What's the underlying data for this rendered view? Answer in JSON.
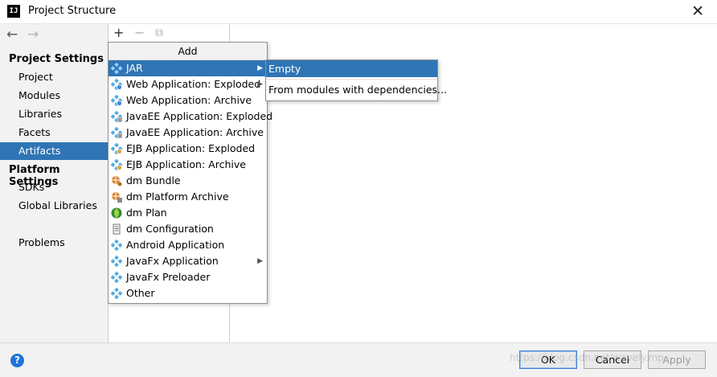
{
  "window": {
    "title": "Project Structure",
    "app_icon_text": "IJ",
    "close_glyph": "✕"
  },
  "nav": {
    "back_glyph": "←",
    "forward_glyph": "→"
  },
  "sidebar": {
    "project_settings_title": "Project Settings",
    "project_items": [
      "Project",
      "Modules",
      "Libraries",
      "Facets",
      "Artifacts"
    ],
    "selected": "Artifacts",
    "platform_settings_title": "Platform Settings",
    "platform_items": [
      "SDKs",
      "Global Libraries"
    ],
    "other_items": [
      "Problems"
    ]
  },
  "toolbar": {
    "add_glyph": "+",
    "remove_glyph": "−",
    "copy_glyph": "⧉"
  },
  "add_menu": {
    "title": "Add",
    "items": [
      {
        "label": "JAR",
        "icon": "artifact-diamond-icon",
        "has_submenu": true,
        "selected": true
      },
      {
        "label": "Web Application: Exploded",
        "icon": "web-app-icon",
        "has_submenu": true
      },
      {
        "label": "Web Application: Archive",
        "icon": "web-app-icon"
      },
      {
        "label": "JavaEE Application: Exploded",
        "icon": "javaee-app-icon"
      },
      {
        "label": "JavaEE Application: Archive",
        "icon": "javaee-app-icon"
      },
      {
        "label": "EJB Application: Exploded",
        "icon": "ejb-app-icon"
      },
      {
        "label": "EJB Application: Archive",
        "icon": "ejb-app-icon"
      },
      {
        "label": "dm Bundle",
        "icon": "dm-bundle-icon"
      },
      {
        "label": "dm Platform Archive",
        "icon": "dm-platform-icon"
      },
      {
        "label": "dm Plan",
        "icon": "dm-plan-icon"
      },
      {
        "label": "dm Configuration",
        "icon": "dm-config-icon"
      },
      {
        "label": "Android Application",
        "icon": "artifact-diamond-icon"
      },
      {
        "label": "JavaFx Application",
        "icon": "artifact-diamond-icon",
        "has_submenu": true
      },
      {
        "label": "JavaFx Preloader",
        "icon": "artifact-diamond-icon"
      },
      {
        "label": "Other",
        "icon": "artifact-diamond-icon"
      }
    ]
  },
  "jar_submenu": {
    "items": [
      "Empty",
      "From modules with dependencies..."
    ],
    "selected": "Empty"
  },
  "buttons": {
    "ok": "OK",
    "cancel": "Cancel",
    "apply": "Apply",
    "help": "?"
  },
  "watermark": "https://blog.csdn.net/wavely.mp",
  "colors": {
    "selection": "#2f75b5",
    "panel_bg": "#f2f2f2",
    "diamond": "#5aa8e0",
    "help": "#1e73d8"
  }
}
